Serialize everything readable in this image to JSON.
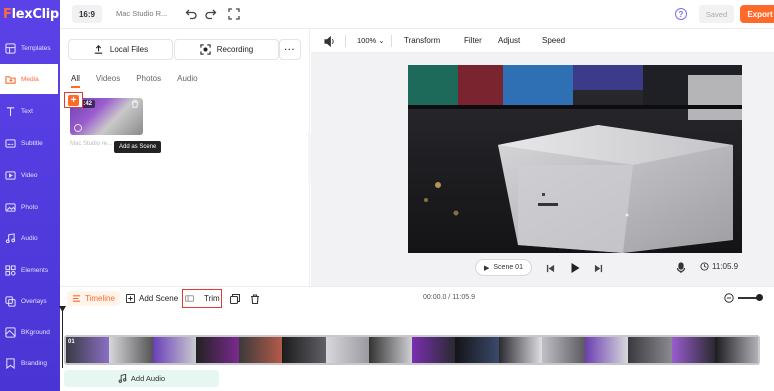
{
  "app": {
    "logo": "FlexClip"
  },
  "sidebar": {
    "items": [
      {
        "label": "Templates",
        "icon": "templates-icon"
      },
      {
        "label": "Media",
        "icon": "media-folder-icon",
        "active": true
      },
      {
        "label": "Text",
        "icon": "text-icon"
      },
      {
        "label": "Subtitle",
        "icon": "subtitle-icon"
      },
      {
        "label": "Video",
        "icon": "video-icon"
      },
      {
        "label": "Photo",
        "icon": "photo-icon"
      },
      {
        "label": "Audio",
        "icon": "audio-icon"
      },
      {
        "label": "Elements",
        "icon": "elements-icon"
      },
      {
        "label": "Overlays",
        "icon": "overlays-icon"
      },
      {
        "label": "BKground",
        "icon": "background-icon"
      },
      {
        "label": "Branding",
        "icon": "branding-icon"
      }
    ]
  },
  "topbar": {
    "ratio": "16:9",
    "project_name": "Mac Studio R...",
    "help": "?",
    "saved": "Saved",
    "export": "Export"
  },
  "media": {
    "local_files": "Local Files",
    "recording": "Recording",
    "tabs": [
      "All",
      "Videos",
      "Photos",
      "Audio"
    ],
    "thumb_duration": "11:42",
    "thumb_name": "Mac Studio re...",
    "tooltip": "Add as Scene"
  },
  "preview_toolbar": {
    "zoom": "100%",
    "transform": "Transform",
    "filter": "Filter",
    "adjust": "Adjust",
    "speed": "Speed"
  },
  "player": {
    "scene": "Scene 01",
    "time": "11:05.9"
  },
  "timeline": {
    "timeline": "Timeline",
    "add_scene": "Add Scene",
    "trim": "Trim",
    "current_time": "00:00.0 / 11:05.9",
    "scene_label": "01",
    "add_audio": "Add Audio"
  },
  "colors": {
    "accent": "#ff6a2b",
    "sidebar": "#5b42e8",
    "highlight": "#e53935"
  }
}
